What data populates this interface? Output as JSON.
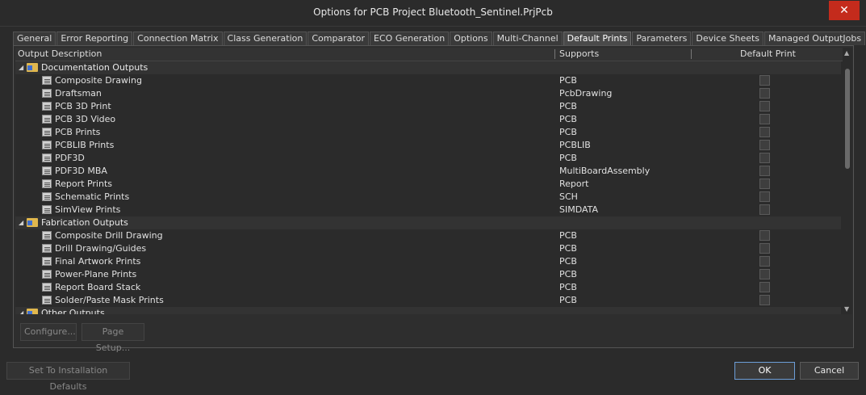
{
  "window": {
    "title": "Options for PCB Project Bluetooth_Sentinel.PrjPcb",
    "close_label": "✕"
  },
  "tabs": [
    {
      "label": "General"
    },
    {
      "label": "Error Reporting"
    },
    {
      "label": "Connection Matrix"
    },
    {
      "label": "Class Generation"
    },
    {
      "label": "Comparator"
    },
    {
      "label": "ECO Generation"
    },
    {
      "label": "Options"
    },
    {
      "label": "Multi-Channel"
    },
    {
      "label": "Default Prints"
    },
    {
      "label": "Parameters"
    },
    {
      "label": "Device Sheets"
    },
    {
      "label": "Managed OutputJobs"
    }
  ],
  "active_tab": "Default Prints",
  "grid": {
    "columns": {
      "description": "Output Description",
      "supports": "Supports",
      "default_print": "Default Print"
    },
    "groups": [
      {
        "name": "Documentation Outputs",
        "expanded": true
      },
      {
        "name": "Fabrication Outputs",
        "expanded": true
      },
      {
        "name": "Other Outputs",
        "expanded": true
      }
    ],
    "documentation_rows": [
      {
        "name": "Composite Drawing",
        "supports": "PCB"
      },
      {
        "name": "Draftsman",
        "supports": "PcbDrawing"
      },
      {
        "name": "PCB 3D Print",
        "supports": "PCB"
      },
      {
        "name": "PCB 3D Video",
        "supports": "PCB"
      },
      {
        "name": "PCB Prints",
        "supports": "PCB"
      },
      {
        "name": "PCBLIB Prints",
        "supports": "PCBLIB"
      },
      {
        "name": "PDF3D",
        "supports": "PCB"
      },
      {
        "name": "PDF3D MBA",
        "supports": "MultiBoardAssembly"
      },
      {
        "name": "Report Prints",
        "supports": "Report"
      },
      {
        "name": "Schematic Prints",
        "supports": "SCH"
      },
      {
        "name": "SimView Prints",
        "supports": "SIMDATA"
      }
    ],
    "fabrication_rows": [
      {
        "name": "Composite Drill Drawing",
        "supports": "PCB"
      },
      {
        "name": "Drill Drawing/Guides",
        "supports": "PCB"
      },
      {
        "name": "Final Artwork Prints",
        "supports": "PCB"
      },
      {
        "name": "Power-Plane Prints",
        "supports": "PCB"
      },
      {
        "name": "Report Board Stack",
        "supports": "PCB"
      },
      {
        "name": "Solder/Paste Mask Prints",
        "supports": "PCB"
      }
    ]
  },
  "panel_buttons": {
    "configure": "Configure...",
    "page_setup": "Page Setup..."
  },
  "footer": {
    "installation_defaults": "Set To Installation Defaults",
    "ok": "OK",
    "cancel": "Cancel"
  },
  "colors": {
    "background": "#2b2b2b",
    "accent": "#6d9ed8",
    "close": "#c42b1c",
    "folder": "#e0b74e"
  }
}
